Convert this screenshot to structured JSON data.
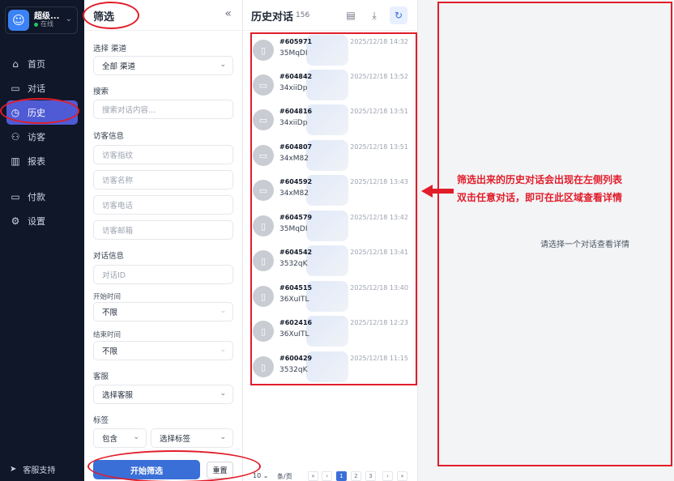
{
  "brand": {
    "name": "超级...",
    "status": "在线"
  },
  "nav": {
    "items": [
      {
        "label": "首页",
        "icon": "home-icon",
        "glyph": "⌂"
      },
      {
        "label": "对话",
        "icon": "chat-icon",
        "glyph": "▭"
      },
      {
        "label": "历史",
        "icon": "clock-icon",
        "glyph": "◷"
      },
      {
        "label": "访客",
        "icon": "users-icon",
        "glyph": "⚇"
      },
      {
        "label": "报表",
        "icon": "chart-icon",
        "glyph": "▥"
      },
      {
        "label": "付款",
        "icon": "card-icon",
        "glyph": "▭"
      },
      {
        "label": "设置",
        "icon": "gear-icon",
        "glyph": "⚙"
      }
    ],
    "active": "历史"
  },
  "support": {
    "label": "客服支持"
  },
  "filter": {
    "title": "筛选",
    "channel": {
      "label": "选择 渠道",
      "value": "全部 渠道"
    },
    "search": {
      "label": "搜索",
      "placeholder": "搜索对话内容..."
    },
    "visitor": {
      "label": "访客信息",
      "fingerprint": "访客指纹",
      "name": "访客名称",
      "phone": "访客电话",
      "email": "访客邮箱"
    },
    "conversation": {
      "label": "对话信息",
      "id": "对话ID",
      "start_label": "开始时间",
      "start_value": "不限",
      "end_label": "结束时间",
      "end_value": "不限"
    },
    "agent": {
      "label": "客服",
      "value": "选择客服"
    },
    "tags": {
      "label": "标签",
      "mode": "包含",
      "value": "选择标签"
    },
    "submit": "开始筛选",
    "reset": "重置"
  },
  "history": {
    "title": "历史对话",
    "count": "156",
    "conversations": [
      {
        "id": "#605971",
        "time": "2025/12/18 14:32",
        "sub": "35MqDI",
        "device": "mobile"
      },
      {
        "id": "#604842",
        "time": "2025/12/18 13:52",
        "sub": "34xiiDp",
        "device": "desktop"
      },
      {
        "id": "#604816",
        "time": "2025/12/18 13:51",
        "sub": "34xiiDp",
        "device": "desktop"
      },
      {
        "id": "#604807",
        "time": "2025/12/18 13:51",
        "sub": "34xM82",
        "device": "desktop"
      },
      {
        "id": "#604592",
        "time": "2025/12/18 13:43",
        "sub": "34xM82",
        "device": "desktop"
      },
      {
        "id": "#604579",
        "time": "2025/12/18 13:42",
        "sub": "35MqDI",
        "device": "mobile"
      },
      {
        "id": "#604542",
        "time": "2025/12/18 13:41",
        "sub": "3532qK",
        "device": "mobile"
      },
      {
        "id": "#604515",
        "time": "2025/12/18 13:40",
        "sub": "36XuITL",
        "device": "mobile"
      },
      {
        "id": "#602416",
        "time": "2025/12/18 12:23",
        "sub": "36XuITL",
        "device": "mobile"
      },
      {
        "id": "#600429",
        "time": "2025/12/18 11:15",
        "sub": "3532qK",
        "device": "mobile"
      }
    ],
    "pager": {
      "size": "10",
      "unit": "条/页",
      "pages": [
        "1",
        "2",
        "3"
      ],
      "current": "1"
    }
  },
  "detail": {
    "empty": "请选择一个对话查看详情"
  },
  "annotation": {
    "line1": "筛选出来的历史对话会出现在左侧列表",
    "line2": "双击任意对话，即可在此区域查看详情"
  },
  "colors": {
    "sidebar": "#0f1729",
    "accent": "#3b6fd8",
    "annotation": "#e11d2a"
  }
}
